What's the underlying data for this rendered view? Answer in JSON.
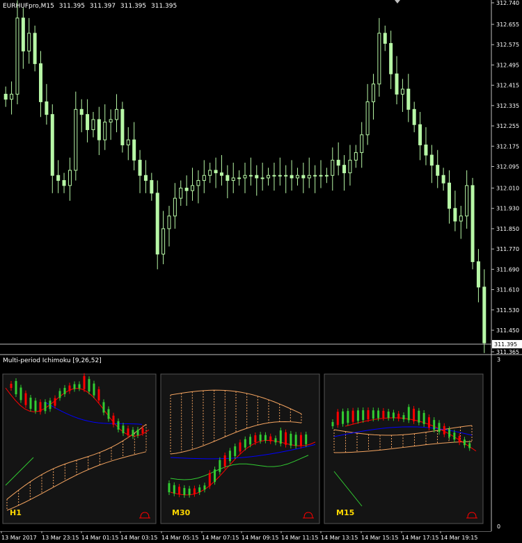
{
  "header": {
    "symbol": "EURHUFpro,M15",
    "ohlc": [
      "311.395",
      "311.397",
      "311.395",
      "311.395"
    ]
  },
  "indicator": {
    "title": "Multi-period Ichimoku [9,26,52]",
    "scale_top": "3",
    "scale_bottom": "0",
    "panels": [
      {
        "label": "H1"
      },
      {
        "label": "M30"
      },
      {
        "label": "M15"
      }
    ]
  },
  "colors": {
    "background": "#000000",
    "bull_candle": "#b7f7a6",
    "grid_text": "#ffffff",
    "tenkan": "#ff0000",
    "kijun": "#0000ff",
    "chikou": "#32cd32",
    "cloud_up": "#f4a460",
    "cloud_down": "#f0f0f0",
    "panel_bg": "#141414",
    "label": "#ffd800"
  },
  "chart_data": {
    "type": "candlestick",
    "price_axis": [
      "312.740",
      "312.655",
      "312.575",
      "312.495",
      "312.415",
      "312.335",
      "312.255",
      "312.175",
      "312.095",
      "312.010",
      "311.930",
      "311.850",
      "311.770",
      "311.690",
      "311.610",
      "311.530",
      "311.450",
      "311.365"
    ],
    "current_price": "311.395",
    "ylim": [
      311.365,
      312.74
    ],
    "time_axis": [
      "13 Mar 2017",
      "13 Mar 23:15",
      "14 Mar 01:15",
      "14 Mar 03:15",
      "14 Mar 05:15",
      "14 Mar 07:15",
      "14 Mar 09:15",
      "14 Mar 11:15",
      "14 Mar 13:15",
      "14 Mar 15:15",
      "14 Mar 17:15",
      "14 Mar 19:15"
    ],
    "close_path": [
      312.36,
      312.38,
      312.68,
      312.55,
      312.62,
      312.5,
      312.35,
      312.3,
      312.06,
      312.04,
      312.02,
      312.08,
      312.32,
      312.3,
      312.24,
      312.28,
      312.2,
      312.27,
      312.28,
      312.32,
      312.18,
      312.2,
      312.12,
      312.06,
      312.04,
      311.99,
      311.75,
      311.85,
      311.9,
      311.97,
      312.01,
      312.0,
      312.02,
      312.04,
      312.06,
      312.08,
      312.07,
      312.06,
      312.04,
      312.05,
      312.05,
      312.06,
      312.06,
      312.05,
      312.05,
      312.06,
      312.06,
      312.06,
      312.06,
      312.05,
      312.06,
      312.05,
      312.06,
      312.06,
      312.06,
      312.06,
      312.12,
      312.1,
      312.07,
      312.12,
      312.15,
      312.22,
      312.35,
      312.42,
      312.62,
      312.58,
      312.46,
      312.38,
      312.4,
      312.32,
      312.26,
      312.18,
      312.14,
      312.1,
      312.06,
      312.03,
      311.93,
      311.88,
      311.9,
      312.02,
      311.72,
      311.62,
      311.4
    ]
  }
}
